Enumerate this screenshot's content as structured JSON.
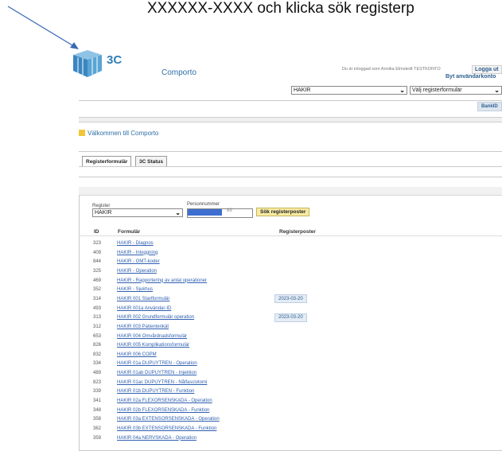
{
  "instruction": "XXXXXX-XXXX och klicka sök registerp",
  "header": {
    "logo_text": "3C",
    "app_name": "Comporto",
    "logged_in": "Du är inloggad som Annika Elmstedt TESTKONTO",
    "logout_label": "Logga ut",
    "switch_account_label": "Byt användarkonto",
    "register_select": "HAKIR",
    "form_select_placeholder": "Välj registerformulär",
    "bankid_label": "BankID"
  },
  "welcome": "Välkommen till Comporto",
  "tabs": [
    {
      "label": "Registerformulär"
    },
    {
      "label": "3C Status"
    }
  ],
  "search": {
    "register_label": "Register",
    "register_value": "HAKIR",
    "personnummer_label": "Personnummer",
    "personnummer_suffix": "89",
    "submit_label": "Sök registerposter"
  },
  "table": {
    "headers": [
      "ID",
      "Formulär",
      "Registerposter"
    ],
    "rows": [
      {
        "id": "323",
        "name": "HAKIR - Diagnos",
        "date": ""
      },
      {
        "id": "409",
        "name": "HAKIR - Inloggning",
        "date": ""
      },
      {
        "id": "844",
        "name": "HAKIR - OMT-koder",
        "date": ""
      },
      {
        "id": "325",
        "name": "HAKIR - Operation",
        "date": ""
      },
      {
        "id": "469",
        "name": "HAKIR - Rapportering av antal operationer",
        "date": ""
      },
      {
        "id": "352",
        "name": "HAKIR - Sjukhus",
        "date": ""
      },
      {
        "id": "314",
        "name": "HAKIR 001 Startformulär",
        "date": "2023-03-20"
      },
      {
        "id": "493",
        "name": "HAKIR 001a Användar-ID",
        "date": ""
      },
      {
        "id": "313",
        "name": "HAKIR 002 Grundformulär operation",
        "date": "2023-03-20"
      },
      {
        "id": "312",
        "name": "HAKIR 003 Patientenkät",
        "date": ""
      },
      {
        "id": "653",
        "name": "HAKIR 004 Omvårdnadsformulär",
        "date": ""
      },
      {
        "id": "826",
        "name": "HAKIR 005 Komplikationsformulär",
        "date": ""
      },
      {
        "id": "832",
        "name": "HAKIR 006 COPM",
        "date": ""
      },
      {
        "id": "334",
        "name": "HAKIR 01a DUPUYTREN - Operation",
        "date": ""
      },
      {
        "id": "489",
        "name": "HAKIR 01ab DUPUYTREN - Injektion",
        "date": ""
      },
      {
        "id": "823",
        "name": "HAKIR 01ac DUPUYTREN - Nålfasciotomi",
        "date": ""
      },
      {
        "id": "339",
        "name": "HAKIR 01b DUPUYTREN - Funktion",
        "date": ""
      },
      {
        "id": "341",
        "name": "HAKIR 02a FLEXORSENSKADA - Operation",
        "date": ""
      },
      {
        "id": "348",
        "name": "HAKIR 02b FLEXORSENSKADA - Funktion",
        "date": ""
      },
      {
        "id": "358",
        "name": "HAKIR 03a EXTENSORSENSKADA - Operation",
        "date": ""
      },
      {
        "id": "362",
        "name": "HAKIR 03b EXTENSORSENSKADA - Funktion",
        "date": ""
      },
      {
        "id": "359",
        "name": "HAKIR 04a NERVSKADA - Operation",
        "date": ""
      }
    ]
  }
}
